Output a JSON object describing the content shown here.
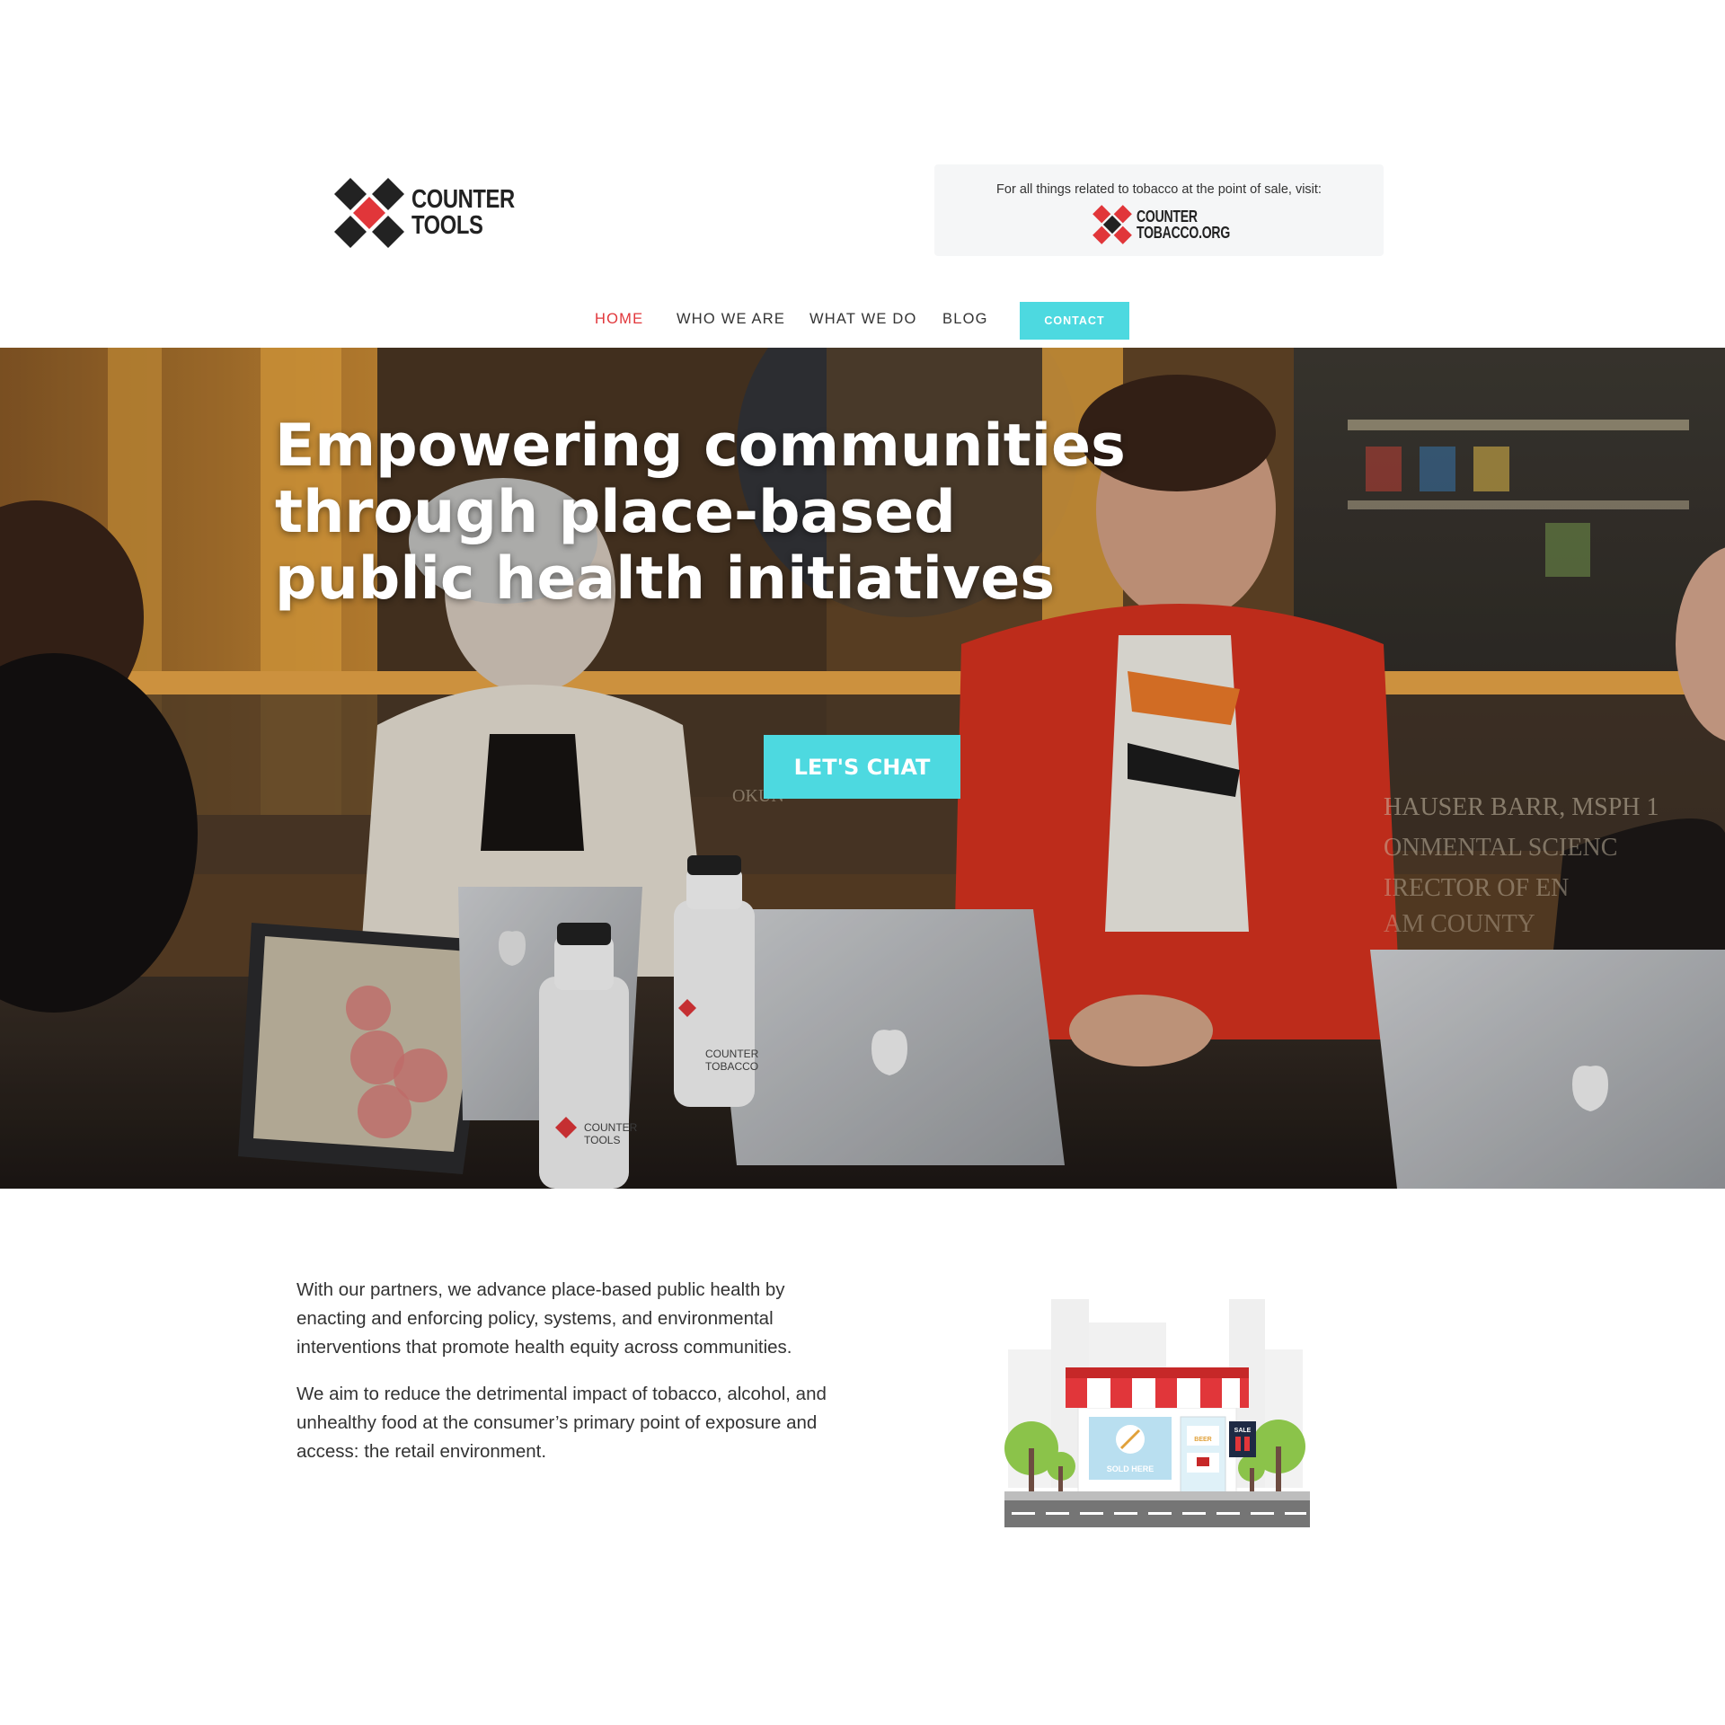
{
  "brand": {
    "logo_line1": "COUNTER",
    "logo_line2": "TOOLS"
  },
  "promo": {
    "text": "For all things related to tobacco at the point of sale, visit:",
    "logo_line1": "COUNTER",
    "logo_line2": "TOBACCO.ORG"
  },
  "nav": {
    "items": [
      {
        "label": "HOME",
        "active": true
      },
      {
        "label": "WHO WE ARE",
        "active": false
      },
      {
        "label": "WHAT WE DO",
        "active": false
      },
      {
        "label": "BLOG",
        "active": false
      }
    ],
    "contact_label": "CONTACT"
  },
  "hero": {
    "title": "Empowering communities through place-based public health initiatives",
    "cta_label": "LET'S CHAT",
    "bottle_text_1": "COUNTER",
    "bottle_text_2": "TOBACCO",
    "bottle_text_3": "COUNTER",
    "bottle_text_4": "TOOLS",
    "glass_text_1": "HAUSER BARR, MSPH 1",
    "glass_text_2": "ONMENTAL SCIENC",
    "glass_text_3": "IRECTOR OF EN",
    "glass_text_4": "AM COUNTY",
    "glass_text_5": "OKUN"
  },
  "content": {
    "paragraph1": "With our partners, we advance place-based public health by enacting and enforcing policy, systems, and environmental interventions that promote health equity across communities.",
    "paragraph2": "We aim to reduce the detrimental impact of tobacco, alcohol, and unhealthy food at the consumer’s primary point of exposure and access: the retail environment."
  },
  "store_illustration": {
    "sign_text": "SOLD HERE",
    "sale_text": "SALE",
    "beer_text": "BEER"
  },
  "colors": {
    "accent": "#4dd9e0",
    "brand_red": "#e1363a",
    "dark": "#222222"
  }
}
